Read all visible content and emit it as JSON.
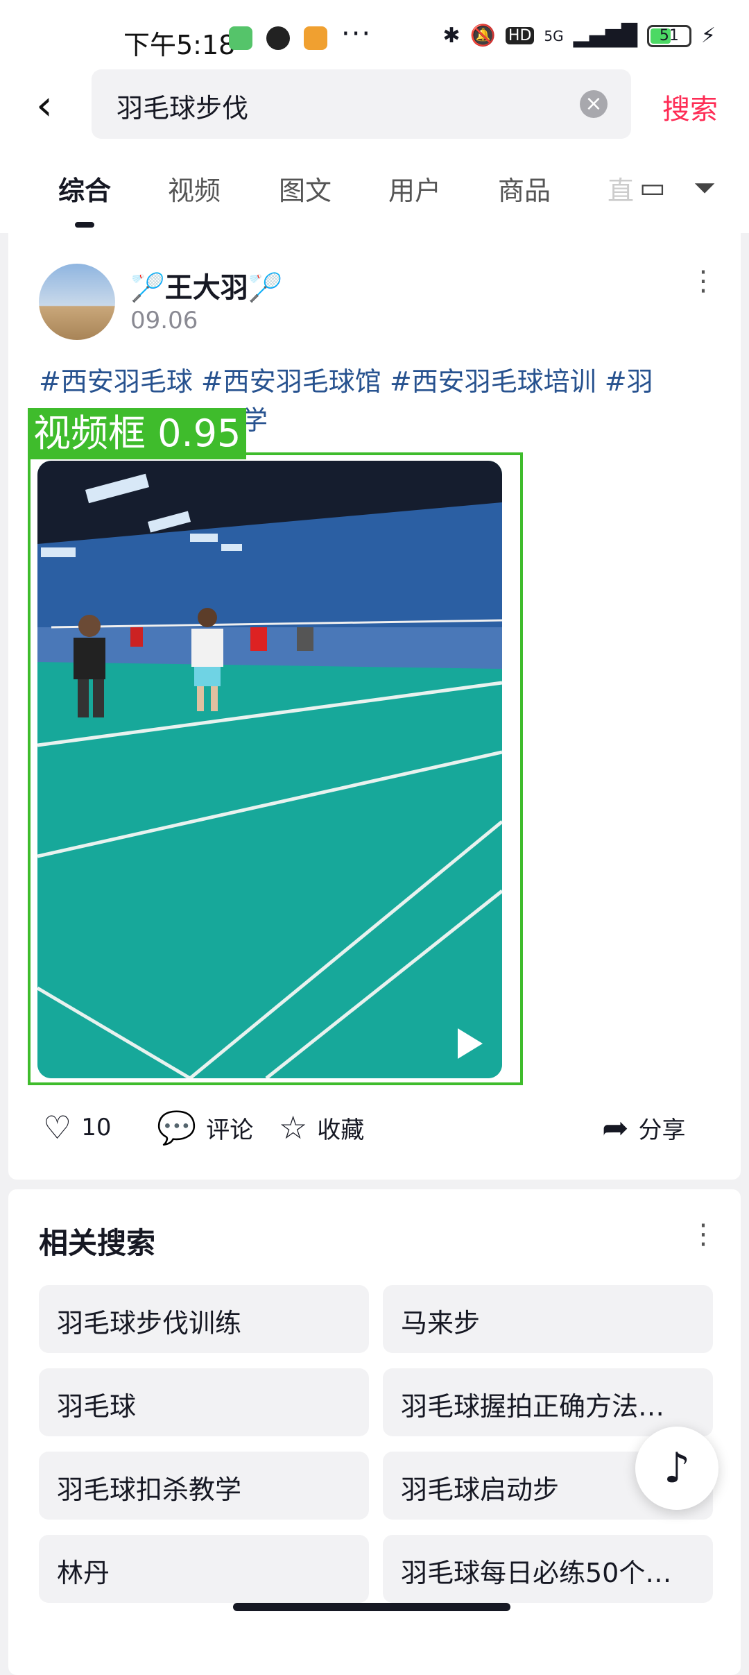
{
  "status_bar": {
    "time": "下午5:18",
    "dots": "···",
    "network": "5G",
    "hd": "HD",
    "battery": "51"
  },
  "search": {
    "query": "羽毛球步伐",
    "search_button": "搜索"
  },
  "tabs": [
    {
      "label": "综合",
      "active": true
    },
    {
      "label": "视频"
    },
    {
      "label": "图文"
    },
    {
      "label": "用户"
    },
    {
      "label": "商品"
    },
    {
      "label": "直"
    }
  ],
  "post": {
    "username": "🏸王大羽🏸",
    "date": "09.06",
    "tags_line1": "#西安羽毛球 #西安羽毛球馆 #西安羽毛球培训 #羽",
    "tags_line2": "学",
    "detection_label": "视频框 0.95",
    "likes": "10",
    "comment_label": "评论",
    "favorite_label": "收藏",
    "share_label": "分享"
  },
  "related": {
    "title": "相关搜索",
    "items": [
      "羽毛球步伐训练",
      "马来步",
      "羽毛球",
      "羽毛球握拍正确方法…",
      "羽毛球扣杀教学",
      "羽毛球启动步",
      "林丹",
      "羽毛球每日必练50个…"
    ]
  },
  "colors": {
    "accent": "#fe2c55",
    "tag": "#27528f",
    "detect": "#3fbc2c"
  }
}
